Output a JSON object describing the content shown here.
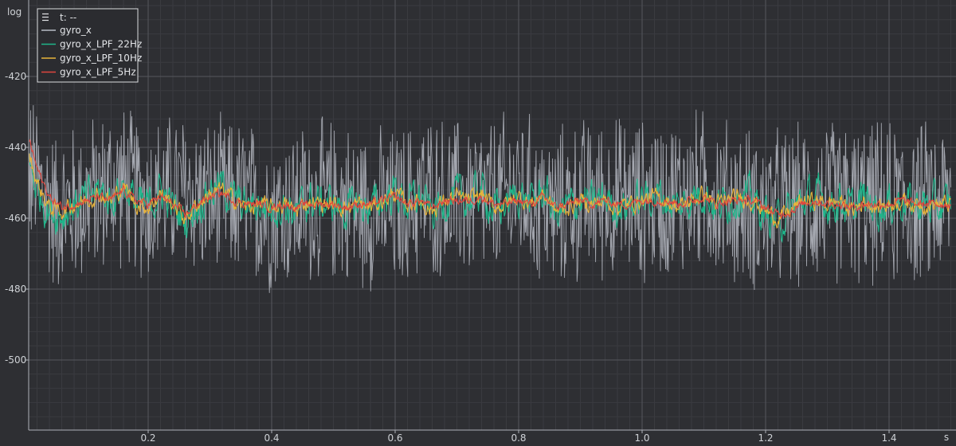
{
  "chart_data": {
    "type": "line",
    "ylabel": "log",
    "xunit": "s",
    "xlim": [
      0.0,
      1.5
    ],
    "ylim": [
      -520,
      -400
    ],
    "x_ticks": [
      "0.2",
      "0.4",
      "0.6",
      "0.8",
      "1.0",
      "1.2",
      "1.4"
    ],
    "x_tick_values": [
      0.2,
      0.4,
      0.6,
      0.8,
      1.0,
      1.2,
      1.4
    ],
    "y_ticks": [
      "-420",
      "-440",
      "-460",
      "-480",
      "-500"
    ],
    "y_tick_values": [
      -420,
      -440,
      -460,
      -480,
      -500
    ],
    "grid": true,
    "legend": {
      "placement": "top-left",
      "header": "t: --",
      "menu_icon": "hamburger-icon",
      "entries": [
        {
          "name": "gyro_x",
          "color": "#b8bcc6"
        },
        {
          "name": "gyro_x_LPF_22Hz",
          "color": "#1fb58a"
        },
        {
          "name": "gyro_x_LPF_10Hz",
          "color": "#e8b33a"
        },
        {
          "name": "gyro_x_LPF_5Hz",
          "color": "#e0463e"
        }
      ]
    },
    "series": [
      {
        "name": "gyro_x",
        "color": "#b8bcc6",
        "x": [
          0.0,
          0.05,
          0.1,
          0.15,
          0.2,
          0.25,
          0.3,
          0.35,
          0.4,
          0.45,
          0.5,
          0.55,
          0.6,
          0.65,
          0.7,
          0.75,
          0.8,
          0.85,
          0.9,
          0.95,
          1.0,
          1.05,
          1.1,
          1.15,
          1.2,
          1.25,
          1.3,
          1.35,
          1.4,
          1.45,
          1.5
        ],
        "values": [
          -445,
          -458,
          -455,
          -450,
          -455,
          -452,
          -455,
          -455,
          -458,
          -456,
          -455,
          -457,
          -458,
          -453,
          -455,
          -455,
          -452,
          -458,
          -455,
          -454,
          -455,
          -454,
          -452,
          -456,
          -458,
          -457,
          -455,
          -456,
          -456,
          -456,
          -455
        ],
        "noise_amplitude": 26
      },
      {
        "name": "gyro_x_LPF_22Hz",
        "color": "#1fb58a",
        "x": [
          0.0,
          0.02,
          0.04,
          0.06,
          0.08,
          0.1,
          0.12,
          0.14,
          0.16,
          0.18,
          0.2,
          0.22,
          0.24,
          0.26,
          0.28,
          0.3,
          0.32,
          0.34,
          0.36,
          0.38,
          0.4,
          0.42,
          0.44,
          0.46,
          0.48,
          0.5,
          0.52,
          0.54,
          0.56,
          0.58,
          0.6,
          0.62,
          0.64,
          0.66,
          0.68,
          0.7,
          0.72,
          0.74,
          0.76,
          0.78,
          0.8,
          0.82,
          0.84,
          0.86,
          0.88,
          0.9,
          0.92,
          0.94,
          0.96,
          0.98,
          1.0,
          1.02,
          1.04,
          1.06,
          1.08,
          1.1,
          1.12,
          1.14,
          1.16,
          1.18,
          1.2,
          1.22,
          1.24,
          1.26,
          1.28,
          1.3,
          1.32,
          1.34,
          1.36,
          1.38,
          1.4,
          1.42,
          1.44,
          1.46,
          1.48,
          1.5
        ],
        "values": [
          -440,
          -452,
          -458,
          -459,
          -456,
          -455,
          -452,
          -455,
          -450,
          -456,
          -457,
          -452,
          -457,
          -461,
          -456,
          -452,
          -451,
          -455,
          -457,
          -456,
          -457,
          -456,
          -459,
          -455,
          -456,
          -456,
          -458,
          -456,
          -457,
          -455,
          -452,
          -456,
          -454,
          -459,
          -455,
          -454,
          -455,
          -452,
          -458,
          -456,
          -453,
          -456,
          -452,
          -459,
          -457,
          -455,
          -456,
          -454,
          -457,
          -456,
          -455,
          -453,
          -455,
          -457,
          -454,
          -452,
          -457,
          -455,
          -453,
          -455,
          -459,
          -461,
          -458,
          -455,
          -454,
          -456,
          -455,
          -458,
          -454,
          -457,
          -456,
          -455,
          -456,
          -456,
          -457,
          -456
        ],
        "noise_amplitude": 7
      },
      {
        "name": "gyro_x_LPF_10Hz",
        "color": "#e8b33a",
        "x": [
          0.0,
          0.02,
          0.04,
          0.06,
          0.08,
          0.1,
          0.12,
          0.14,
          0.16,
          0.18,
          0.2,
          0.22,
          0.24,
          0.26,
          0.28,
          0.3,
          0.32,
          0.34,
          0.36,
          0.38,
          0.4,
          0.42,
          0.44,
          0.46,
          0.48,
          0.5,
          0.52,
          0.54,
          0.56,
          0.58,
          0.6,
          0.62,
          0.64,
          0.66,
          0.68,
          0.7,
          0.72,
          0.74,
          0.76,
          0.78,
          0.8,
          0.82,
          0.84,
          0.86,
          0.88,
          0.9,
          0.92,
          0.94,
          0.96,
          0.98,
          1.0,
          1.02,
          1.04,
          1.06,
          1.08,
          1.1,
          1.12,
          1.14,
          1.16,
          1.18,
          1.2,
          1.22,
          1.24,
          1.26,
          1.28,
          1.3,
          1.32,
          1.34,
          1.36,
          1.38,
          1.4,
          1.42,
          1.44,
          1.46,
          1.48,
          1.5
        ],
        "values": [
          -438,
          -450,
          -457,
          -458,
          -456,
          -455,
          -453,
          -455,
          -451,
          -456,
          -457,
          -453,
          -456,
          -460,
          -456,
          -453,
          -452,
          -455,
          -457,
          -456,
          -457,
          -456,
          -458,
          -455,
          -456,
          -456,
          -457,
          -456,
          -457,
          -455,
          -453,
          -456,
          -455,
          -458,
          -455,
          -454,
          -455,
          -453,
          -457,
          -456,
          -454,
          -456,
          -453,
          -458,
          -457,
          -455,
          -456,
          -455,
          -457,
          -456,
          -455,
          -454,
          -455,
          -457,
          -455,
          -453,
          -456,
          -455,
          -454,
          -455,
          -458,
          -460,
          -458,
          -455,
          -455,
          -456,
          -455,
          -458,
          -455,
          -457,
          -456,
          -455,
          -456,
          -456,
          -456,
          -456
        ],
        "noise_amplitude": 3
      },
      {
        "name": "gyro_x_LPF_5Hz",
        "color": "#e0463e",
        "x": [
          0.0,
          0.02,
          0.04,
          0.06,
          0.08,
          0.1,
          0.12,
          0.14,
          0.16,
          0.18,
          0.2,
          0.22,
          0.24,
          0.26,
          0.28,
          0.3,
          0.32,
          0.34,
          0.36,
          0.38,
          0.4,
          0.42,
          0.44,
          0.46,
          0.48,
          0.5,
          0.52,
          0.54,
          0.56,
          0.58,
          0.6,
          0.62,
          0.64,
          0.66,
          0.68,
          0.7,
          0.72,
          0.74,
          0.76,
          0.78,
          0.8,
          0.82,
          0.84,
          0.86,
          0.88,
          0.9,
          0.92,
          0.94,
          0.96,
          0.98,
          1.0,
          1.02,
          1.04,
          1.06,
          1.08,
          1.1,
          1.12,
          1.14,
          1.16,
          1.18,
          1.2,
          1.22,
          1.24,
          1.26,
          1.28,
          1.3,
          1.32,
          1.34,
          1.36,
          1.38,
          1.4,
          1.42,
          1.44,
          1.46,
          1.48,
          1.5
        ],
        "values": [
          -433,
          -446,
          -454,
          -457,
          -456,
          -455,
          -454,
          -455,
          -452,
          -455,
          -456,
          -454,
          -456,
          -459,
          -456,
          -454,
          -453,
          -455,
          -456,
          -456,
          -457,
          -456,
          -457,
          -456,
          -456,
          -456,
          -457,
          -456,
          -456,
          -455,
          -454,
          -456,
          -455,
          -457,
          -455,
          -455,
          -455,
          -454,
          -456,
          -456,
          -455,
          -456,
          -454,
          -457,
          -456,
          -455,
          -456,
          -455,
          -456,
          -456,
          -455,
          -455,
          -455,
          -456,
          -455,
          -454,
          -456,
          -455,
          -455,
          -455,
          -457,
          -459,
          -458,
          -456,
          -455,
          -456,
          -456,
          -457,
          -456,
          -456,
          -456,
          -455,
          -456,
          -456,
          -456,
          -456
        ],
        "noise_amplitude": 1.5
      }
    ]
  }
}
